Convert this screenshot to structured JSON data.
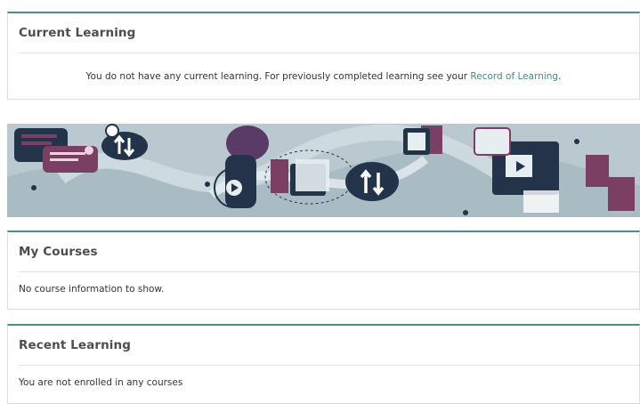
{
  "current_learning": {
    "title": "Current Learning",
    "message_prefix": "You do not have any current learning. For previously completed learning see your ",
    "record_link": "Record of Learning",
    "message_suffix": "."
  },
  "my_courses": {
    "title": "My Courses",
    "message": "No course information to show."
  },
  "recent_learning": {
    "title": "Recent Learning",
    "message": "You are not enrolled in any courses"
  },
  "colors": {
    "accent_border": "#4a8f8c",
    "link": "#3f8a86",
    "banner_bg": "#b6c6cc",
    "banner_dark": "#2b3a4a",
    "banner_purple": "#7b3f63"
  }
}
